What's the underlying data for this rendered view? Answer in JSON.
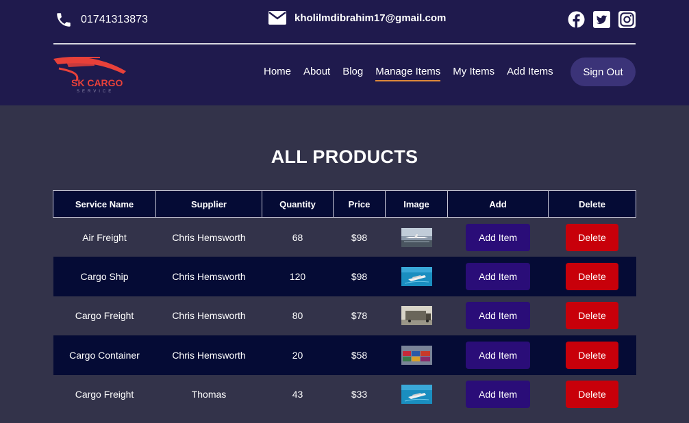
{
  "contact": {
    "phone": "01741313873",
    "email": "kholilmdibrahim17@gmail.com"
  },
  "socials": [
    "facebook-icon",
    "twitter-icon",
    "instagram-icon"
  ],
  "logo": {
    "brand": "SK CARGO",
    "tagline": "SERVICE"
  },
  "nav": {
    "items": [
      "Home",
      "About",
      "Blog",
      "Manage Items",
      "My Items",
      "Add Items"
    ],
    "active": "Manage Items",
    "signout": "Sign Out"
  },
  "page": {
    "title": "ALL PRODUCTS"
  },
  "table": {
    "headers": [
      "Service Name",
      "Supplier",
      "Quantity",
      "Price",
      "Image",
      "Add",
      "Delete"
    ],
    "rows": [
      {
        "name": "Air Freight",
        "supplier": "Chris Hemsworth",
        "quantity": "68",
        "price": "$98",
        "image": "airplane-photo",
        "add": "Add Item",
        "delete": "Delete"
      },
      {
        "name": "Cargo Ship",
        "supplier": "Chris Hemsworth",
        "quantity": "120",
        "price": "$98",
        "image": "ship-photo",
        "add": "Add Item",
        "delete": "Delete"
      },
      {
        "name": "Cargo Freight",
        "supplier": "Chris Hemsworth",
        "quantity": "80",
        "price": "$78",
        "image": "truck-photo",
        "add": "Add Item",
        "delete": "Delete"
      },
      {
        "name": "Cargo Container",
        "supplier": "Chris Hemsworth",
        "quantity": "20",
        "price": "$58",
        "image": "containers-photo",
        "add": "Add Item",
        "delete": "Delete"
      },
      {
        "name": "Cargo Freight",
        "supplier": "Thomas",
        "quantity": "43",
        "price": "$33",
        "image": "ship-photo",
        "add": "Add Item",
        "delete": "Delete"
      }
    ]
  },
  "colors": {
    "header_bg": "#1f1a4d",
    "page_bg": "#33334a",
    "table_dark": "#050b35",
    "add_button": "#2a0d78",
    "delete_button": "#c8000a",
    "signout_button": "#3b3378",
    "logo_red": "#e8413a",
    "active_underline": "#e08a3a"
  }
}
